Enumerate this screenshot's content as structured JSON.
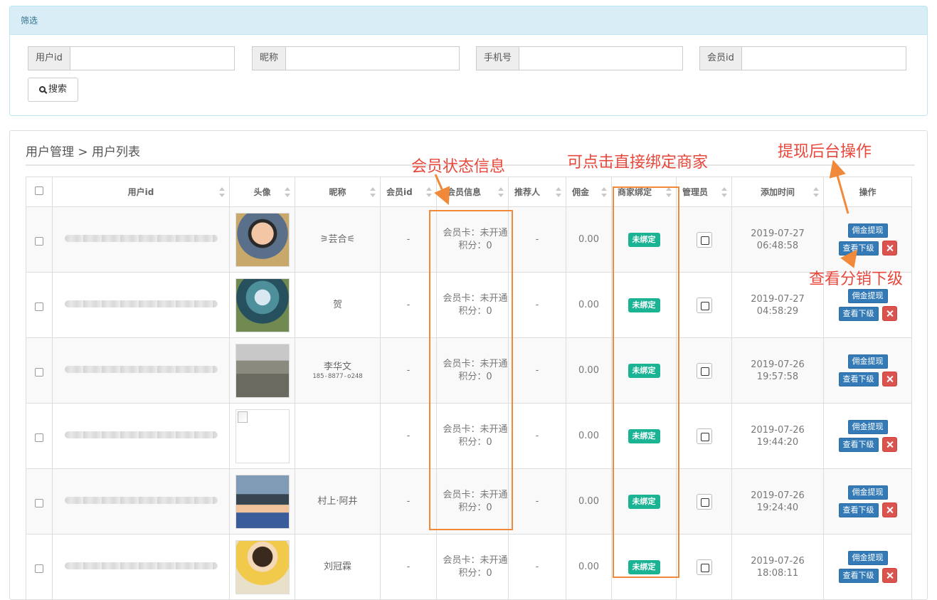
{
  "filter": {
    "title": "筛选",
    "fields": [
      {
        "label": "用户id",
        "placeholder": ""
      },
      {
        "label": "昵称",
        "placeholder": ""
      },
      {
        "label": "手机号",
        "placeholder": ""
      },
      {
        "label": "会员id",
        "placeholder": ""
      }
    ],
    "search_label": "搜索"
  },
  "breadcrumb": "用户管理 > 用户列表",
  "table": {
    "headers": [
      "用户id",
      "头像",
      "昵称",
      "会员id",
      "会员信息",
      "推荐人",
      "佣金",
      "商家绑定",
      "管理员",
      "添加时间",
      "操作"
    ],
    "rows": [
      {
        "nickname": "⚞芸合⚟",
        "phone": "",
        "member_id": "-",
        "card": "会员卡：未开通",
        "points": "积分：0",
        "referrer": "-",
        "commission": "0.00",
        "bind": "未绑定",
        "date": "2019-07-27",
        "time": "06:48:58"
      },
      {
        "nickname": "贺",
        "phone": "",
        "member_id": "-",
        "card": "会员卡：未开通",
        "points": "积分：0",
        "referrer": "-",
        "commission": "0.00",
        "bind": "未绑定",
        "date": "2019-07-27",
        "time": "04:58:29"
      },
      {
        "nickname": "李华文",
        "phone": "185-8877-o248",
        "member_id": "-",
        "card": "会员卡：未开通",
        "points": "积分：0",
        "referrer": "-",
        "commission": "0.00",
        "bind": "未绑定",
        "date": "2019-07-26",
        "time": "19:57:58"
      },
      {
        "nickname": "",
        "phone": "",
        "member_id": "-",
        "card": "会员卡：未开通",
        "points": "积分：0",
        "referrer": "-",
        "commission": "0.00",
        "bind": "未绑定",
        "date": "2019-07-26",
        "time": "19:44:20"
      },
      {
        "nickname": "村上·阿井",
        "phone": "",
        "member_id": "-",
        "card": "会员卡：未开通",
        "points": "积分：0",
        "referrer": "-",
        "commission": "0.00",
        "bind": "未绑定",
        "date": "2019-07-26",
        "time": "19:24:40"
      },
      {
        "nickname": "刘冠霖",
        "phone": "",
        "member_id": "-",
        "card": "会员卡：未开通",
        "points": "积分：0",
        "referrer": "-",
        "commission": "0.00",
        "bind": "未绑定",
        "date": "2019-07-26",
        "time": "18:08:11"
      }
    ],
    "btn_withdraw": "佣金提现",
    "btn_sub": "查看下级"
  },
  "annotations": {
    "member_status": "会员状态信息",
    "bind_merchant": "可点击直接绑定商家",
    "withdraw_op": "提现后台操作",
    "view_sub": "查看分销下级"
  },
  "colors": {
    "primary": "#337ab7",
    "success": "#1ab394",
    "danger": "#d9534f",
    "annotation": "#e8473b",
    "annotation_box": "#f08a3a"
  }
}
